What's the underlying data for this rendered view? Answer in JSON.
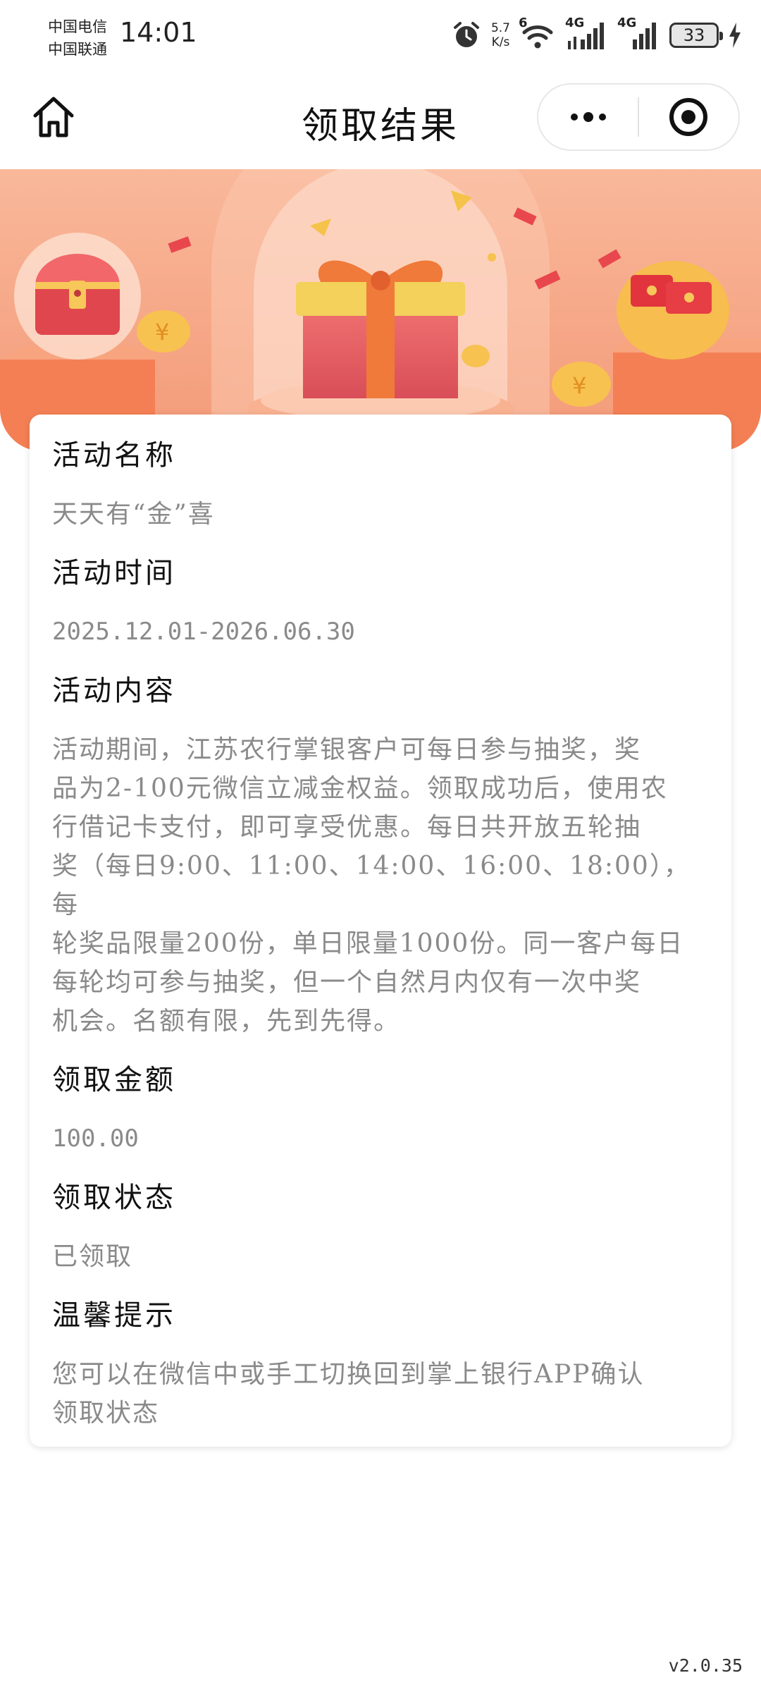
{
  "status_bar": {
    "carrier_1": "中国电信",
    "carrier_2": "中国联通",
    "time": "14:01",
    "net_speed_value": "5.7",
    "net_speed_unit": "K/s",
    "signal_1_label": "4G",
    "signal_2_label": "4G",
    "wifi_label": "6",
    "battery": "33",
    "icons": [
      "alarm-icon",
      "wifi-icon",
      "signal-icon",
      "battery-icon",
      "charging-icon"
    ]
  },
  "nav": {
    "title": "领取结果",
    "home_icon": "home-icon",
    "more_icon": "more-dots-icon",
    "close_icon": "target-close-icon"
  },
  "colors": {
    "banner_bg": "#f6a886",
    "gift_red": "#e05a5f",
    "ribbon_orange": "#f07a3a",
    "gold": "#f6c255"
  },
  "card": {
    "activity_name_label": "活动名称",
    "activity_name": "天天有“金”喜",
    "activity_time_label": "活动时间",
    "activity_time": "2025.12.01-2026.06.30",
    "activity_content_label": "活动内容",
    "activity_content_lines": [
      "活动期间，江苏农行掌银客户可每日参与抽奖，奖",
      "品为2-100元微信立减金权益。领取成功后，使用农",
      "行借记卡支付，即可享受优惠。每日共开放五轮抽",
      "奖（每日9:00、11:00、14:00、16:00、18:00），每",
      "轮奖品限量200份，单日限量1000份。同一客户每日",
      "每轮均可参与抽奖，但一个自然月内仅有一次中奖",
      "机会。名额有限，先到先得。"
    ],
    "amount_label": "领取金额",
    "amount": "100.00",
    "status_label": "领取状态",
    "status": "已领取",
    "tip_label": "温馨提示",
    "tip_lines": [
      "您可以在微信中或手工切换回到掌上银行APP确认",
      "领取状态"
    ]
  },
  "version": "v2.0.35"
}
